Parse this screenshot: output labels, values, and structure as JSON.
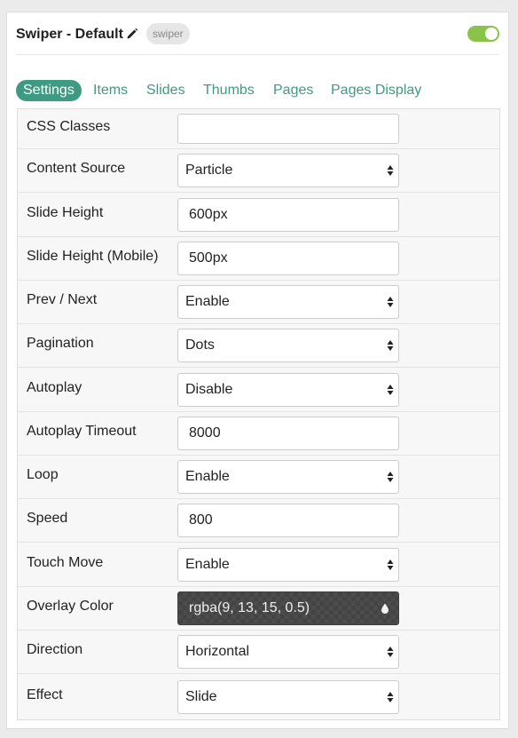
{
  "header": {
    "title": "Swiper - Default",
    "badge": "swiper",
    "icons": {
      "edit": "pencil-icon",
      "toggle": "enabled-toggle"
    },
    "toggle_on": true,
    "accent_color": "#3f9a83",
    "toggle_color": "#8bc34a"
  },
  "tabs": [
    {
      "label": "Settings",
      "active": true
    },
    {
      "label": "Items"
    },
    {
      "label": "Slides"
    },
    {
      "label": "Thumbs"
    },
    {
      "label": "Pages"
    },
    {
      "label": "Pages Display"
    }
  ],
  "settings": [
    {
      "label": "CSS Classes",
      "type": "input",
      "value": ""
    },
    {
      "label": "Content Source",
      "type": "select",
      "value": "Particle"
    },
    {
      "label": "Slide Height",
      "type": "input",
      "value": "600px"
    },
    {
      "label": "Slide Height (Mobile)",
      "type": "input",
      "value": "500px"
    },
    {
      "label": "Prev / Next",
      "type": "select",
      "value": "Enable"
    },
    {
      "label": "Pagination",
      "type": "select",
      "value": "Dots"
    },
    {
      "label": "Autoplay",
      "type": "select",
      "value": "Disable"
    },
    {
      "label": "Autoplay Timeout",
      "type": "input",
      "value": "8000"
    },
    {
      "label": "Loop",
      "type": "select",
      "value": "Enable"
    },
    {
      "label": "Speed",
      "type": "input",
      "value": "800"
    },
    {
      "label": "Touch Move",
      "type": "select",
      "value": "Enable"
    },
    {
      "label": "Overlay Color",
      "type": "color",
      "value": "rgba(9, 13, 15, 0.5)",
      "icon": "color-drop-icon"
    },
    {
      "label": "Direction",
      "type": "select",
      "value": "Horizontal"
    },
    {
      "label": "Effect",
      "type": "select",
      "value": "Slide"
    }
  ]
}
